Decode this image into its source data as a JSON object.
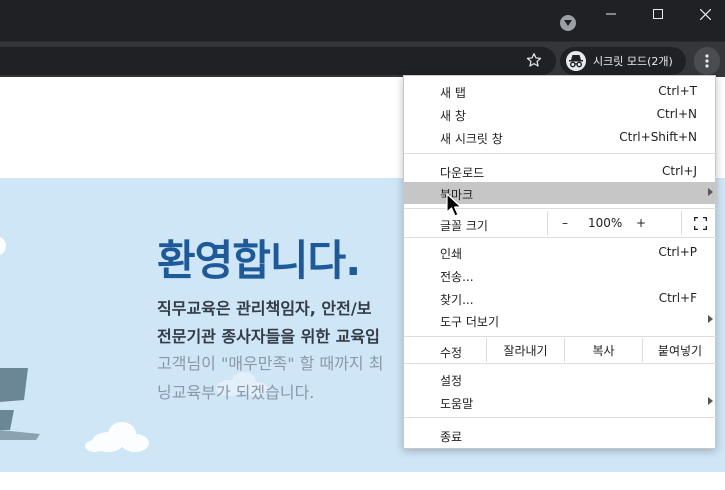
{
  "window": {
    "controls": [
      "minimize",
      "maximize",
      "close"
    ],
    "colors": {
      "frame": "#202124",
      "toolbar": "#35363a",
      "accent_text": "#e8eaed"
    }
  },
  "toolbar": {
    "incognito_label": "시크릿 모드(2개)"
  },
  "hero": {
    "title": "환영합니다.",
    "line1": "직무교육은 관리책임자, 안전/보",
    "line2": "전문기관 종사자들을 위한 교육입",
    "line3": "고객님이 \"매우만족\" 할 때까지 최",
    "line4": "닝교육부가 되겠습니다.",
    "colors": {
      "background": "#cfe6f7",
      "title": "#1e5a99"
    }
  },
  "menu": {
    "group1": [
      {
        "label": "새 탭",
        "shortcut": "Ctrl+T"
      },
      {
        "label": "새 창",
        "shortcut": "Ctrl+N"
      },
      {
        "label": "새 시크릿 창",
        "shortcut": "Ctrl+Shift+N"
      }
    ],
    "group2": [
      {
        "label": "다운로드",
        "shortcut": "Ctrl+J"
      },
      {
        "label": "북마크",
        "shortcut": ""
      }
    ],
    "zoom": {
      "label": "글꼴 크기",
      "minus": "–",
      "value": "100%",
      "plus": "+"
    },
    "group3": [
      {
        "label": "인쇄",
        "shortcut": "Ctrl+P"
      },
      {
        "label": "전송...",
        "shortcut": ""
      },
      {
        "label": "찾기...",
        "shortcut": "Ctrl+F"
      },
      {
        "label": "도구 더보기",
        "shortcut": ""
      }
    ],
    "edit": {
      "label": "수정",
      "cut": "잘라내기",
      "copy": "복사",
      "paste": "붙여넣기"
    },
    "group4": [
      {
        "label": "설정",
        "shortcut": ""
      },
      {
        "label": "도움말",
        "shortcut": ""
      }
    ],
    "exit": {
      "label": "종료"
    },
    "highlighted_item": "북마크"
  }
}
